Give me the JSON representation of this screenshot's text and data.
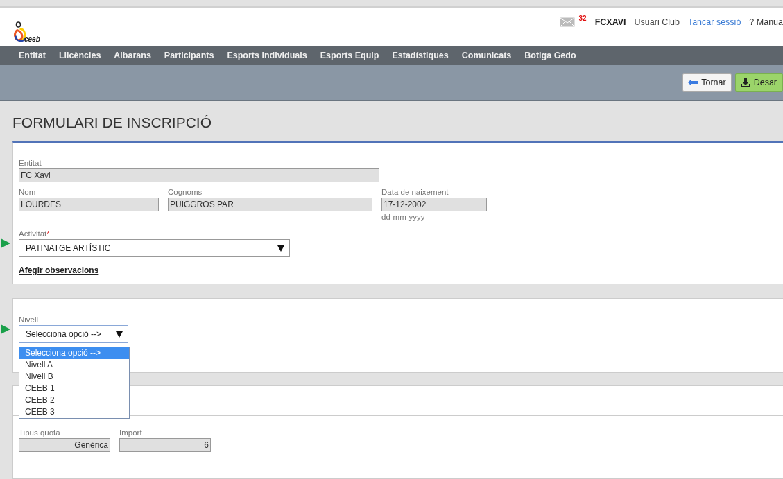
{
  "header": {
    "logo_text": "ceeb",
    "message_count": "32",
    "user": "FCXAVI",
    "role": "Usuari Club",
    "logout": "Tancar sessió",
    "manual": "? Manua"
  },
  "nav": [
    "Entitat",
    "Llicències",
    "Albarans",
    "Participants",
    "Esports Individuals",
    "Esports Equip",
    "Estadístiques",
    "Comunicats",
    "Botiga Gedo"
  ],
  "toolbar": {
    "back": "Tornar",
    "save": "Desar"
  },
  "title": "FORMULARI DE INSCRIPCIÓ",
  "form": {
    "entitat": {
      "label": "Entitat",
      "value": "FC Xavi"
    },
    "nom": {
      "label": "Nom",
      "value": "LOURDES"
    },
    "cognoms": {
      "label": "Cognoms",
      "value": "PUIGGROS PAR"
    },
    "data": {
      "label": "Data de naixement",
      "value": "17-12-2002",
      "hint": "dd-mm-yyyy"
    },
    "activitat": {
      "label": "Activitat",
      "required_mark": "*",
      "value": "PATINATGE ARTÍSTIC"
    },
    "observacions_link": "Afegir observacions"
  },
  "nivell": {
    "label": "Nivell",
    "value": "Selecciona opció -->",
    "expanded": true,
    "options": [
      {
        "label": "Selecciona opció -->",
        "selected": true
      },
      {
        "label": "Nivell A",
        "selected": false
      },
      {
        "label": "Nivell B",
        "selected": false
      },
      {
        "label": "CEEB 1",
        "selected": false
      },
      {
        "label": "CEEB 2",
        "selected": false
      },
      {
        "label": "CEEB 3",
        "selected": false
      }
    ]
  },
  "quota": {
    "tipus": {
      "label": "Tipus quota",
      "value": "Genèrica"
    },
    "import": {
      "label": "Import",
      "value": "6"
    }
  }
}
